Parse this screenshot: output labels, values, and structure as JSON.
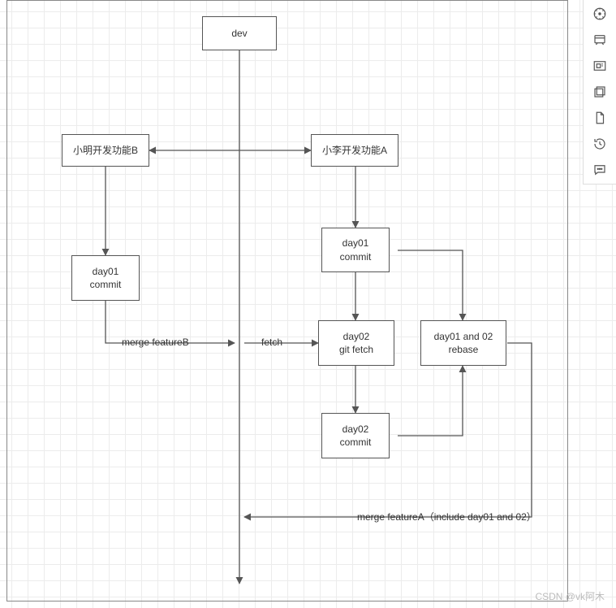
{
  "nodes": {
    "dev": "dev",
    "xm": "小明开发功能B",
    "xl": "小李开发功能A",
    "b_d1": "day01\ncommit",
    "a_d1": "day01\ncommit",
    "a_fetch": "day02\ngit fetch",
    "a_d2": "day02\ncommit",
    "a_rebase": "day01 and 02\nrebase"
  },
  "labels": {
    "mergeB": "merge featureB",
    "fetch": "fetch",
    "mergeA": "merge featureA（include day01 and 02）"
  },
  "toolbar_icons": [
    "compass-icon",
    "theme-icon",
    "fit-icon",
    "layers-icon",
    "page-icon",
    "history-icon",
    "comment-icon"
  ],
  "watermark": "CSDN @vk阿木"
}
